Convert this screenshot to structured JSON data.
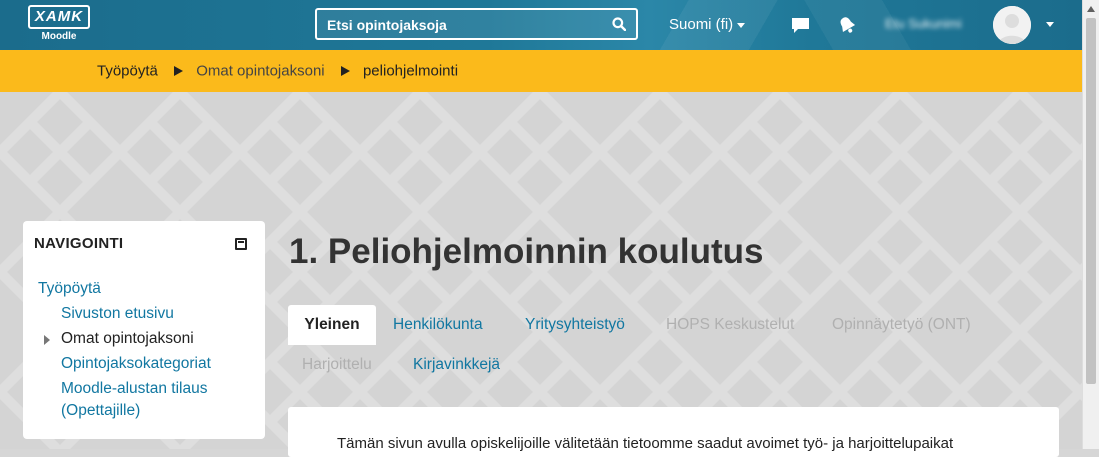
{
  "header": {
    "logo_text": "XAMK",
    "logo_sub": "Moodle",
    "search_placeholder": "Etsi opintojaksoja",
    "language": "Suomi (fi)",
    "username": "Etu Sukunimi",
    "icons": [
      "search-icon",
      "chat-icon",
      "bell-icon",
      "avatar",
      "caret-down-icon"
    ]
  },
  "breadcrumb": {
    "items": [
      "Työpöytä",
      "Omat opintojaksoni",
      "peliohjelmointi"
    ]
  },
  "navigation": {
    "title": "NAVIGOINTI",
    "items": [
      "Työpöytä",
      "Sivuston etusivu",
      "Omat opintojaksoni",
      "Opintojaksokategoriat",
      "Moodle-alustan tilaus",
      "(Opettajille)"
    ]
  },
  "main": {
    "title": "1. Peliohjelmoinnin koulutus",
    "tabs": [
      "Yleinen",
      "Henkilökunta",
      "Yritysyhteistyö",
      "HOPS Keskustelut",
      "Opinnäytetyö (ONT)",
      "Harjoittelu",
      "Kirjavinkkejä"
    ],
    "intro_text": "Tämän sivun avulla opiskelijoille välitetään tietoomme saadut avoimet työ- ja harjoittelupaikat"
  },
  "colors": {
    "navbar": "#1f7898",
    "breadcrumb_bar": "#fbba1b",
    "link": "#1177a1",
    "muted_tab": "#b0b0b0"
  }
}
